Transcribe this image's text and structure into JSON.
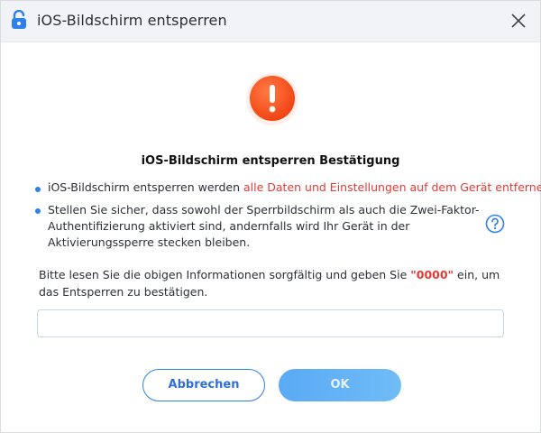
{
  "window": {
    "title": "iOS-Bildschirm entsperren"
  },
  "dialog": {
    "heading": "iOS-Bildschirm entsperren Bestätigung",
    "bullet1": {
      "text": "iOS-Bildschirm entsperren werden ",
      "highlight": "alle Daten und Einstellungen auf dem Gerät entfernen"
    },
    "bullet2": {
      "text": "Stellen Sie sicher, dass sowohl der Sperrbildschirm als auch die Zwei-Faktor-Authentifizierung aktiviert sind, andernfalls wird Ihr Gerät in der Aktivierungssperre stecken bleiben."
    },
    "instruction": {
      "before": "Bitte lesen Sie die obigen Informationen sorgfältig und geben Sie ",
      "code": "\"0000\"",
      "after": " ein, um das Entsperren zu bestätigen."
    },
    "input": {
      "value": "",
      "placeholder": ""
    },
    "buttons": {
      "cancel": "Abbrechen",
      "ok": "OK"
    }
  },
  "icons": {
    "title": "unlock-icon",
    "close": "close-icon",
    "warning": "exclamation-icon",
    "help": "question-icon"
  },
  "colors": {
    "accent": "#2f80ed",
    "warning": "#f4511e",
    "highlight": "#e53935"
  }
}
